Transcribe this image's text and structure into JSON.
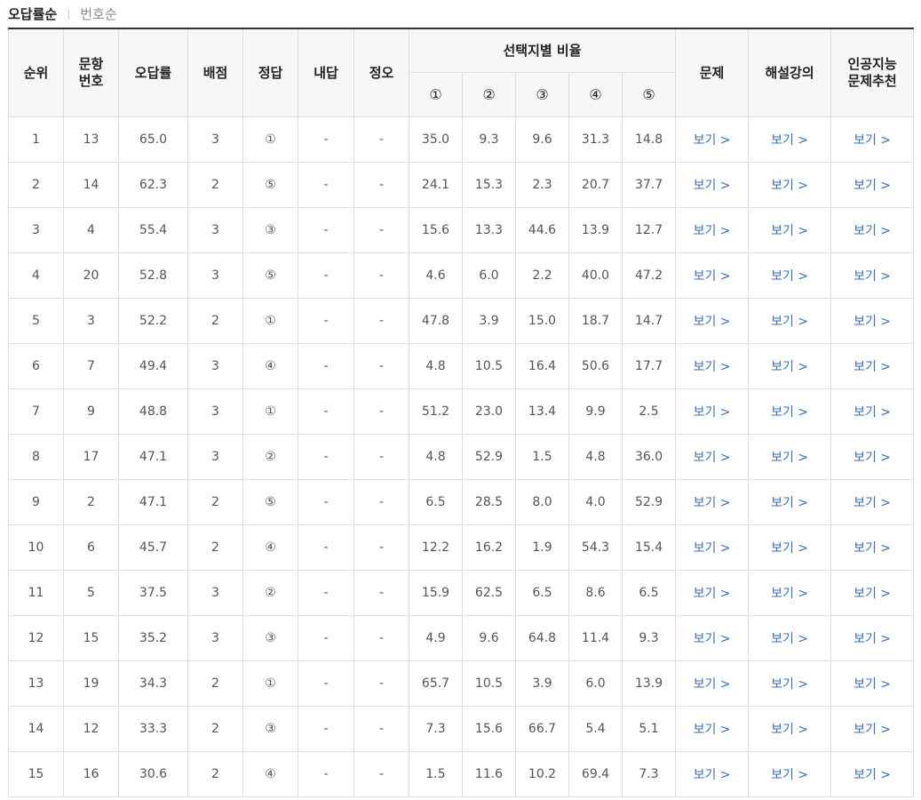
{
  "sort_tabs": {
    "active": "오답률순",
    "inactive": "번호순"
  },
  "table": {
    "headers": {
      "rank": "순위",
      "qnum_line1": "문항",
      "qnum_line2": "번호",
      "wrong_rate": "오답률",
      "points": "배점",
      "answer": "정답",
      "my_answer": "내답",
      "correct_wrong": "정오",
      "choice_ratio": "선택지별 비율",
      "choices": [
        "①",
        "②",
        "③",
        "④",
        "⑤"
      ],
      "problem": "문제",
      "lecture": "해설강의",
      "ai_line1": "인공지능",
      "ai_line2": "문제추천"
    },
    "link_label": "보기 >",
    "rows": [
      {
        "rank": "1",
        "qnum": "13",
        "wrong_rate": "65.0",
        "points": "3",
        "answer": "①",
        "mine": "-",
        "ox": "-",
        "ratios": [
          "35.0",
          "9.3",
          "9.6",
          "31.3",
          "14.8"
        ]
      },
      {
        "rank": "2",
        "qnum": "14",
        "wrong_rate": "62.3",
        "points": "2",
        "answer": "⑤",
        "mine": "-",
        "ox": "-",
        "ratios": [
          "24.1",
          "15.3",
          "2.3",
          "20.7",
          "37.7"
        ]
      },
      {
        "rank": "3",
        "qnum": "4",
        "wrong_rate": "55.4",
        "points": "3",
        "answer": "③",
        "mine": "-",
        "ox": "-",
        "ratios": [
          "15.6",
          "13.3",
          "44.6",
          "13.9",
          "12.7"
        ]
      },
      {
        "rank": "4",
        "qnum": "20",
        "wrong_rate": "52.8",
        "points": "3",
        "answer": "⑤",
        "mine": "-",
        "ox": "-",
        "ratios": [
          "4.6",
          "6.0",
          "2.2",
          "40.0",
          "47.2"
        ]
      },
      {
        "rank": "5",
        "qnum": "3",
        "wrong_rate": "52.2",
        "points": "2",
        "answer": "①",
        "mine": "-",
        "ox": "-",
        "ratios": [
          "47.8",
          "3.9",
          "15.0",
          "18.7",
          "14.7"
        ]
      },
      {
        "rank": "6",
        "qnum": "7",
        "wrong_rate": "49.4",
        "points": "3",
        "answer": "④",
        "mine": "-",
        "ox": "-",
        "ratios": [
          "4.8",
          "10.5",
          "16.4",
          "50.6",
          "17.7"
        ]
      },
      {
        "rank": "7",
        "qnum": "9",
        "wrong_rate": "48.8",
        "points": "3",
        "answer": "①",
        "mine": "-",
        "ox": "-",
        "ratios": [
          "51.2",
          "23.0",
          "13.4",
          "9.9",
          "2.5"
        ]
      },
      {
        "rank": "8",
        "qnum": "17",
        "wrong_rate": "47.1",
        "points": "3",
        "answer": "②",
        "mine": "-",
        "ox": "-",
        "ratios": [
          "4.8",
          "52.9",
          "1.5",
          "4.8",
          "36.0"
        ]
      },
      {
        "rank": "9",
        "qnum": "2",
        "wrong_rate": "47.1",
        "points": "2",
        "answer": "⑤",
        "mine": "-",
        "ox": "-",
        "ratios": [
          "6.5",
          "28.5",
          "8.0",
          "4.0",
          "52.9"
        ]
      },
      {
        "rank": "10",
        "qnum": "6",
        "wrong_rate": "45.7",
        "points": "2",
        "answer": "④",
        "mine": "-",
        "ox": "-",
        "ratios": [
          "12.2",
          "16.2",
          "1.9",
          "54.3",
          "15.4"
        ]
      },
      {
        "rank": "11",
        "qnum": "5",
        "wrong_rate": "37.5",
        "points": "3",
        "answer": "②",
        "mine": "-",
        "ox": "-",
        "ratios": [
          "15.9",
          "62.5",
          "6.5",
          "8.6",
          "6.5"
        ]
      },
      {
        "rank": "12",
        "qnum": "15",
        "wrong_rate": "35.2",
        "points": "3",
        "answer": "③",
        "mine": "-",
        "ox": "-",
        "ratios": [
          "4.9",
          "9.6",
          "64.8",
          "11.4",
          "9.3"
        ]
      },
      {
        "rank": "13",
        "qnum": "19",
        "wrong_rate": "34.3",
        "points": "2",
        "answer": "①",
        "mine": "-",
        "ox": "-",
        "ratios": [
          "65.7",
          "10.5",
          "3.9",
          "6.0",
          "13.9"
        ]
      },
      {
        "rank": "14",
        "qnum": "12",
        "wrong_rate": "33.3",
        "points": "2",
        "answer": "③",
        "mine": "-",
        "ox": "-",
        "ratios": [
          "7.3",
          "15.6",
          "66.7",
          "5.4",
          "5.1"
        ]
      },
      {
        "rank": "15",
        "qnum": "16",
        "wrong_rate": "30.6",
        "points": "2",
        "answer": "④",
        "mine": "-",
        "ox": "-",
        "ratios": [
          "1.5",
          "11.6",
          "10.2",
          "69.4",
          "7.3"
        ]
      }
    ]
  },
  "colors": {
    "link": "#3a6fb5",
    "wrong_mark": "#e5443b",
    "header_bg": "#f7f7f7"
  }
}
